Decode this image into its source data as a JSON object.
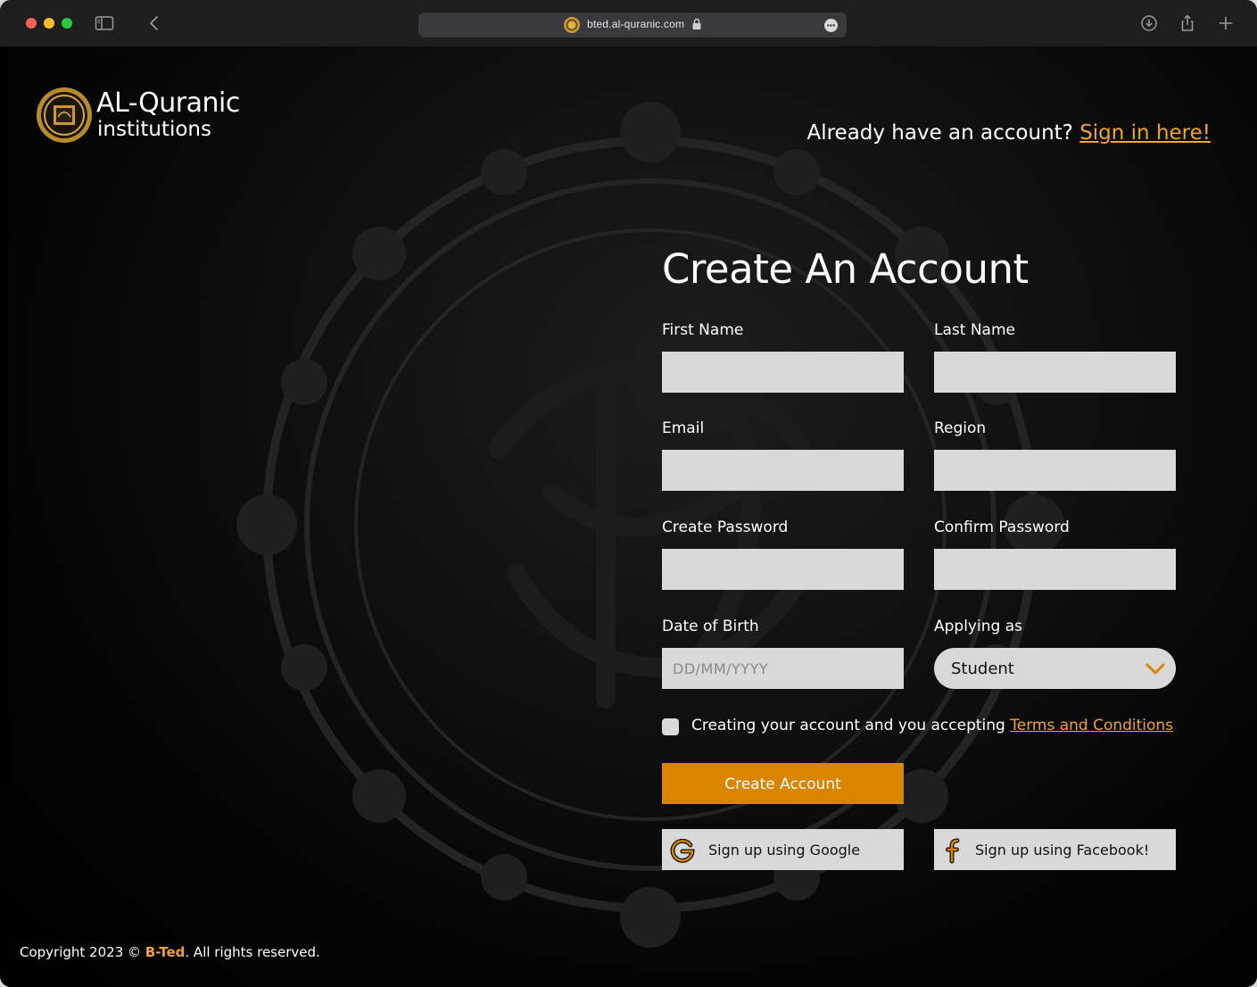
{
  "browser": {
    "url": "bted.al-quranic.com",
    "icons": {
      "sidebar": "sidebar-icon",
      "back": "chevron-left-icon",
      "lock": "lock-icon",
      "more": "ellipsis-icon",
      "download": "download-icon",
      "share": "share-icon",
      "new_tab": "plus-icon"
    }
  },
  "header": {
    "logo_title": "AL-Quranic",
    "logo_subtitle": "institutions",
    "signin_prompt": "Already have an account? ",
    "signin_link": "Sign in here!"
  },
  "form": {
    "title": "Create An Account",
    "first_name_label": "First Name",
    "last_name_label": "Last Name",
    "email_label": "Email",
    "region_label": "Region",
    "create_password_label": "Create Password",
    "confirm_password_label": "Confirm Password",
    "dob_label": "Date of Birth",
    "dob_placeholder": "DD/MM/YYYY",
    "applying_as_label": "Applying as",
    "applying_as_value": "Student",
    "terms_text": "Creating your account and you accepting ",
    "terms_link": "Terms and Conditions",
    "submit_label": "Create Account",
    "google_label": "Sign up using Google",
    "facebook_label": "Sign up using Facebook!"
  },
  "footer": {
    "prefix": "Copyright 2023 © ",
    "brand": "B-Ted",
    "suffix": ". All rights reserved."
  },
  "colors": {
    "accent": "#da8500",
    "link": "#f0a330",
    "input_bg": "#d9d9d9",
    "page_bg": "#000000"
  }
}
